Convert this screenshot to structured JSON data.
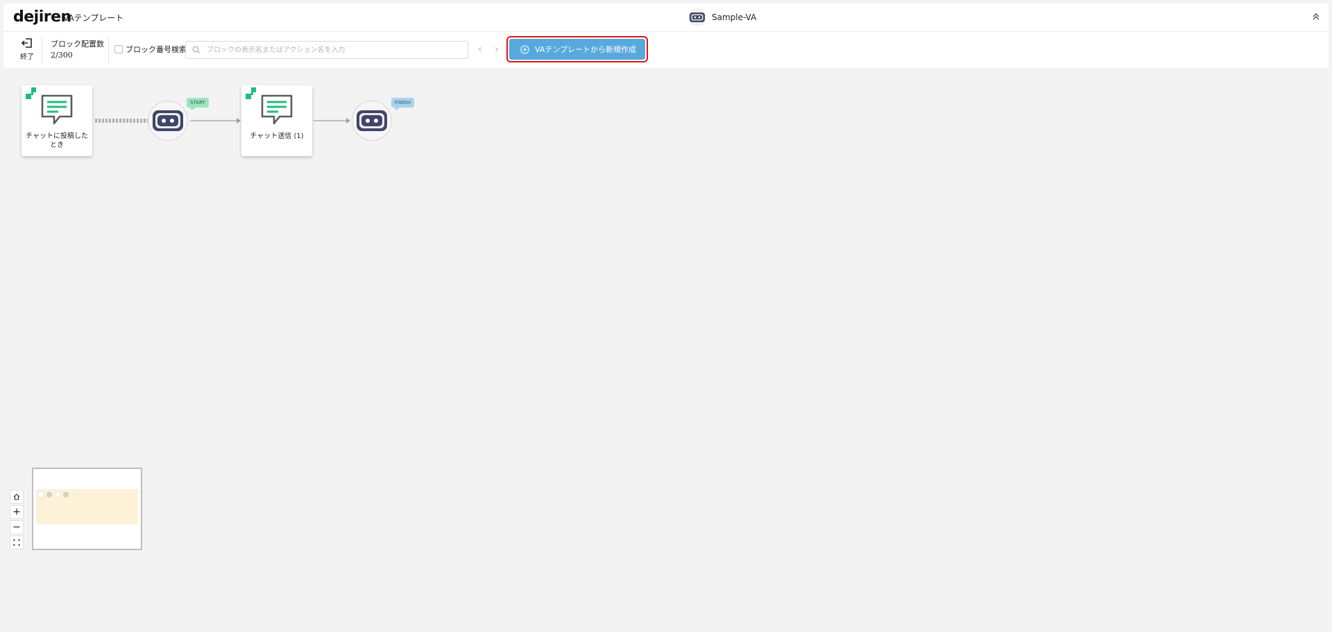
{
  "header": {
    "logo": "dejiren",
    "app_title": "VAテンプレート",
    "va_name": "Sample-VA"
  },
  "toolbar": {
    "exit_label": "終了",
    "block_count_label": "ブロック配置数",
    "block_count_value": "2/300",
    "search_by_number_label": "ブロック番号検索",
    "search_placeholder": "ブロックの表示名またはアクション名を入力",
    "search_value": "",
    "create_from_template_label": "VAテンプレートから新規作成"
  },
  "flow": {
    "blocks": [
      {
        "caption": "チャットに投稿したとき"
      },
      {
        "caption": "チャット送信 (1)"
      }
    ],
    "start_tag": "START",
    "finish_tag": "FINISH"
  },
  "zoom": {
    "home_icon": "home-icon",
    "zoom_in": "+",
    "zoom_out": "−",
    "fit_icon": "fit-screen-icon"
  },
  "colors": {
    "accent_button": "#57a9dd",
    "highlight_border": "#e01010",
    "brand_green": "#1fbd7e",
    "start_tag": "#9de3c2",
    "finish_tag": "#a9d2ec",
    "va_icon": "#414566"
  }
}
